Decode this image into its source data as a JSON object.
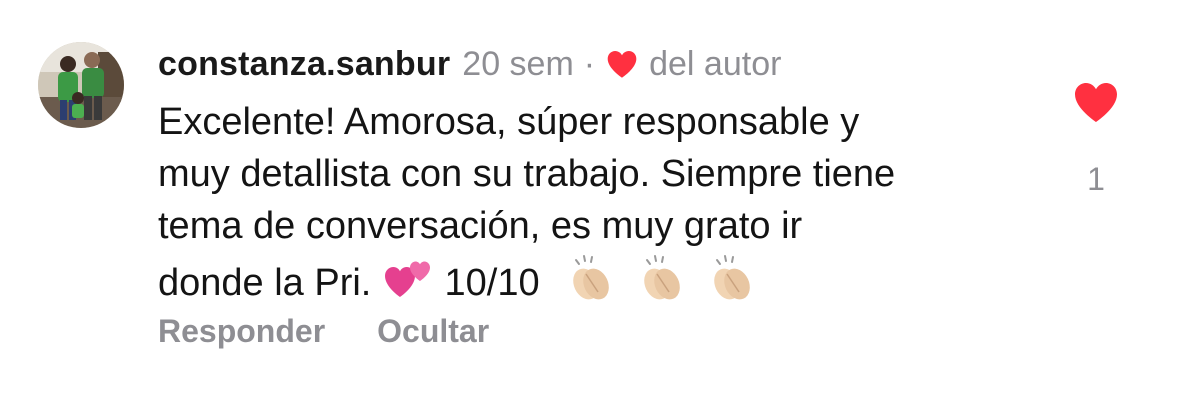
{
  "comment": {
    "username": "constanza.sanbur",
    "time": "20 sem",
    "separator": "·",
    "author_like_label": "del autor",
    "text_lines": [
      "Excelente! Amorosa, súper responsable y",
      "muy detallista con su trabajo. Siempre tiene",
      "tema de conversación, es muy grato ir"
    ],
    "last_line_prefix": "donde la Pri.",
    "last_line_score": "10/10",
    "emojis": [
      "two-hearts-icon",
      "clapping-hands-icon",
      "clapping-hands-icon",
      "clapping-hands-icon"
    ],
    "actions": {
      "reply": "Responder",
      "hide": "Ocultar"
    },
    "like_count": "1"
  },
  "colors": {
    "like_red": "#ff3040",
    "muted": "#8e8e93",
    "text": "#141414"
  }
}
